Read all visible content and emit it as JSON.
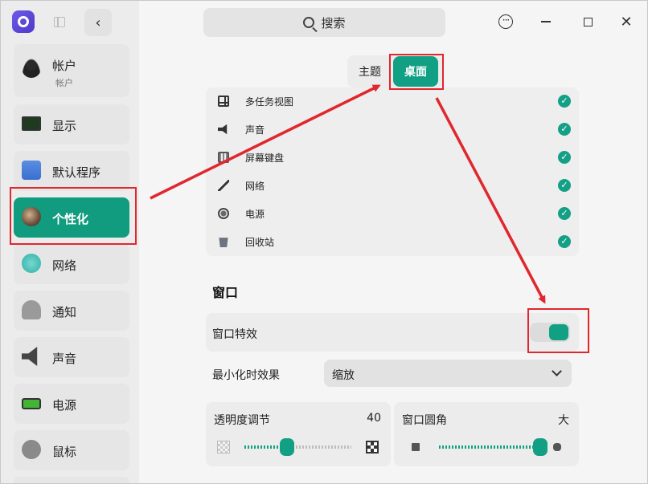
{
  "search": {
    "label": "搜索"
  },
  "sidebar": {
    "account": {
      "label": "帐户",
      "sub": "帐户"
    },
    "items": [
      {
        "label": "显示"
      },
      {
        "label": "默认程序"
      },
      {
        "label": "个性化"
      },
      {
        "label": "网络"
      },
      {
        "label": "通知"
      },
      {
        "label": "声音"
      },
      {
        "label": "电源"
      },
      {
        "label": "鼠标"
      }
    ]
  },
  "tabs": [
    {
      "label": "主题"
    },
    {
      "label": "桌面"
    }
  ],
  "dock_items": [
    {
      "label": "多任务视图",
      "checked": true
    },
    {
      "label": "声音",
      "checked": true
    },
    {
      "label": "屏幕键盘",
      "checked": true
    },
    {
      "label": "网络",
      "checked": true
    },
    {
      "label": "电源",
      "checked": true
    },
    {
      "label": "回收站",
      "checked": true
    }
  ],
  "window_section": {
    "title": "窗口",
    "effect_label": "窗口特效",
    "effect_on": true,
    "minimize_label": "最小化时效果",
    "minimize_value": "缩放",
    "opacity_label": "透明度调节",
    "opacity_value": "40",
    "opacity_fraction": 0.4,
    "radius_label": "窗口圆角",
    "radius_value": "大",
    "radius_fraction": 1.0
  },
  "colors": {
    "accent": "#11a083",
    "annotation": "#e0272e"
  },
  "check_mark": "✓"
}
